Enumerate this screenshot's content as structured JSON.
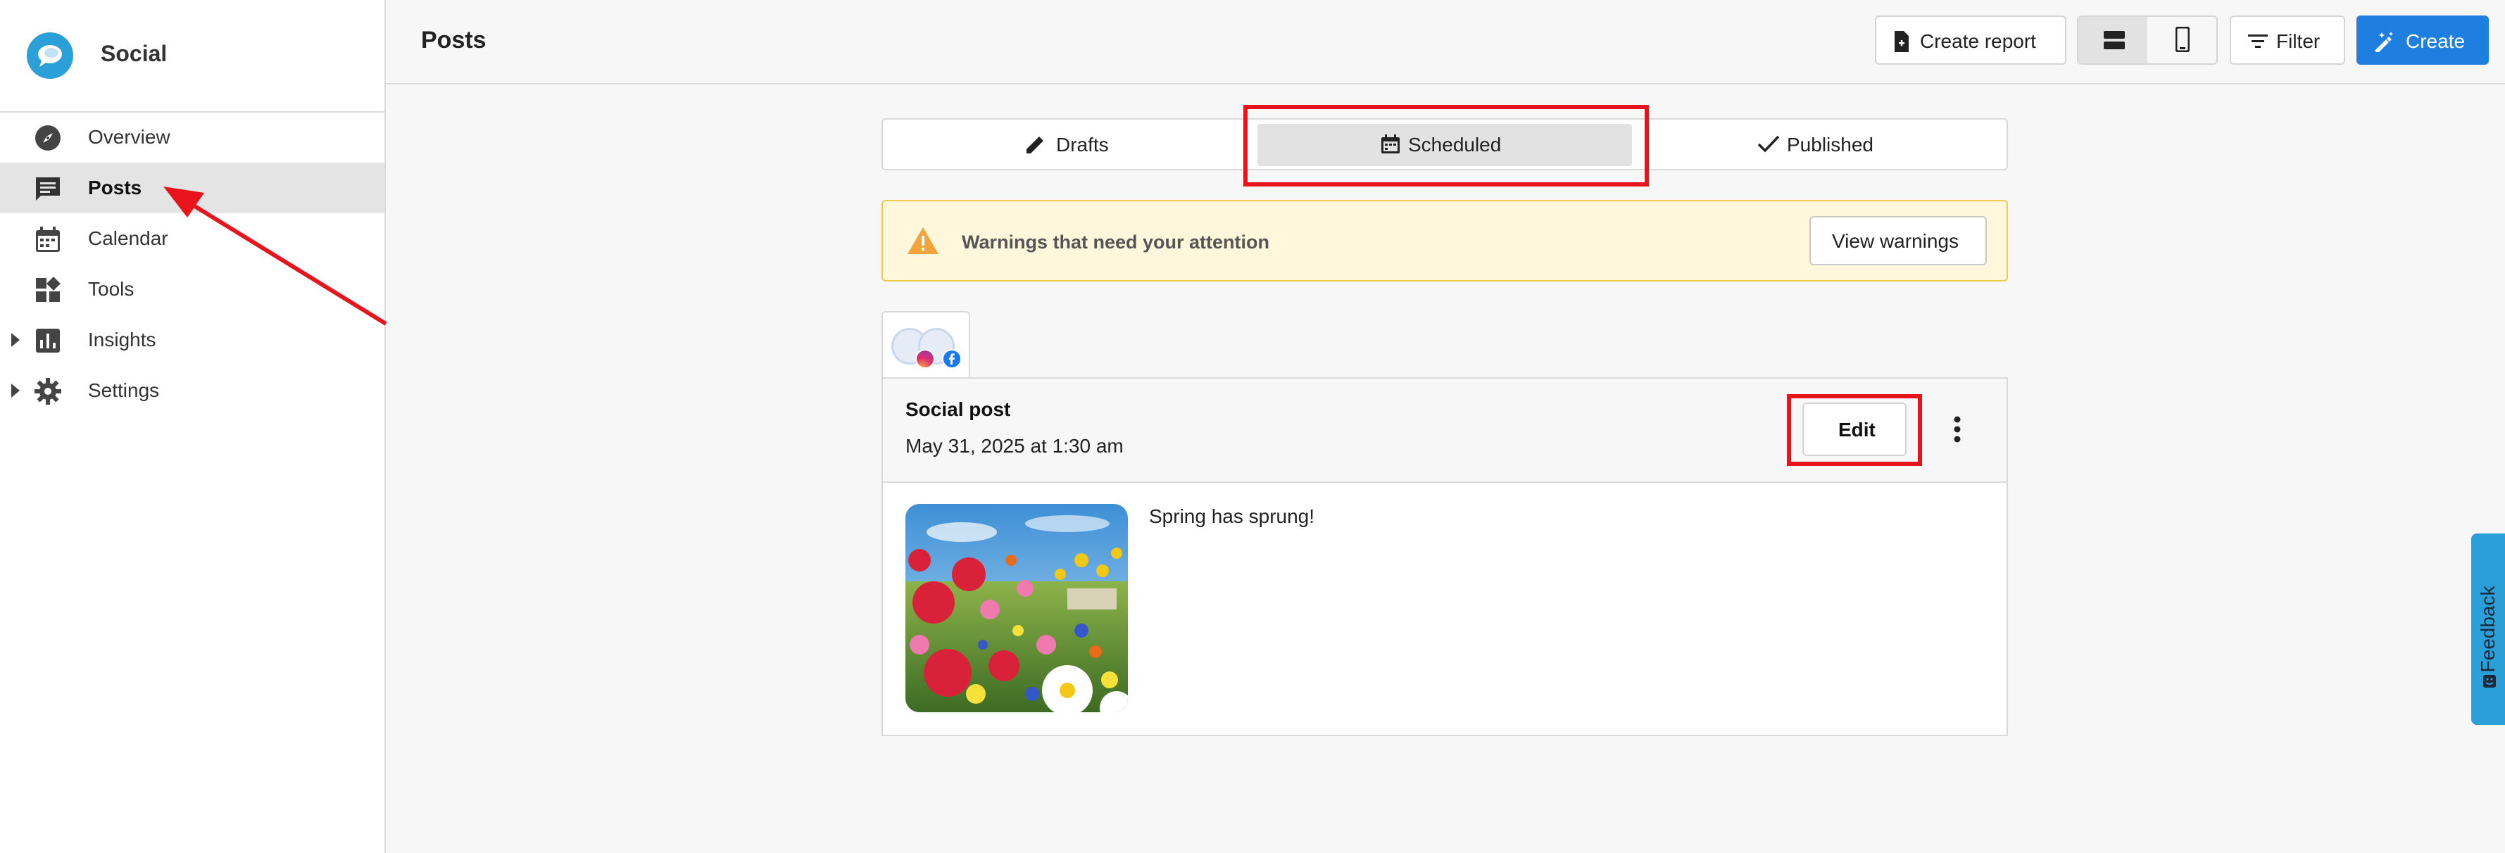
{
  "app": {
    "name": "Social"
  },
  "sidebar": {
    "items": [
      {
        "label": "Overview",
        "icon": "compass-icon"
      },
      {
        "label": "Posts",
        "icon": "posts-icon",
        "active": true
      },
      {
        "label": "Calendar",
        "icon": "calendar-icon"
      },
      {
        "label": "Tools",
        "icon": "tools-icon"
      },
      {
        "label": "Insights",
        "icon": "insights-icon",
        "expandable": true
      },
      {
        "label": "Settings",
        "icon": "gear-icon",
        "expandable": true
      }
    ]
  },
  "header": {
    "title": "Posts",
    "create_report_label": "Create report",
    "filter_label": "Filter",
    "create_label": "Create"
  },
  "tabs": [
    {
      "label": "Drafts",
      "icon": "pencil-icon"
    },
    {
      "label": "Scheduled",
      "icon": "calendar-icon",
      "selected": true
    },
    {
      "label": "Published",
      "icon": "check-icon"
    }
  ],
  "warning": {
    "text": "Warnings that need your attention",
    "button_label": "View warnings",
    "color": "#f2a33a"
  },
  "post": {
    "networks": [
      "instagram",
      "facebook"
    ],
    "type": "Social post",
    "date": "May 31, 2025 at 1:30 am",
    "edit_label": "Edit",
    "text": "Spring has sprung!",
    "image": "flower-field-image"
  },
  "feedback": {
    "label": "Feedback"
  },
  "colors": {
    "accent": "#1e7fe0",
    "brand": "#2a9fd8",
    "highlight": "#e8141b",
    "warning_bg": "#fef7db"
  }
}
